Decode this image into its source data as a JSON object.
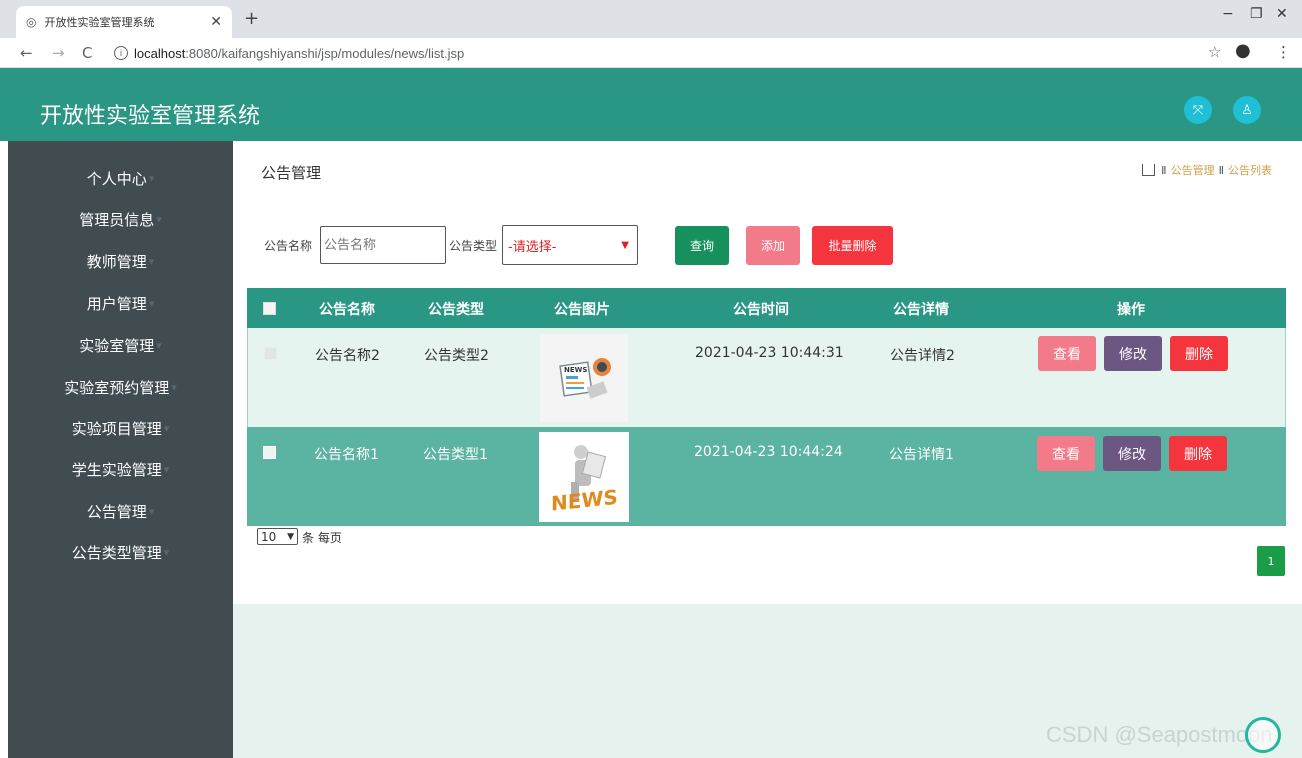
{
  "browser": {
    "tab_title": "开放性实验室管理系统",
    "tab_icon": "settings-icon",
    "url_host": "localhost",
    "url_rest": ":8080/kaifangshiyanshi/jsp/modules/news/list.jsp"
  },
  "header": {
    "title": "开放性实验室管理系统",
    "accent": "#2a9684"
  },
  "sidebar": {
    "items": [
      {
        "label": "个人中心"
      },
      {
        "label": "管理员信息"
      },
      {
        "label": "教师管理"
      },
      {
        "label": "用户管理"
      },
      {
        "label": "实验室管理"
      },
      {
        "label": "实验室预约管理"
      },
      {
        "label": "实验项目管理"
      },
      {
        "label": "学生实验管理"
      },
      {
        "label": "公告管理"
      },
      {
        "label": "公告类型管理"
      }
    ]
  },
  "page": {
    "title": "公告管理",
    "breadcrumb": [
      "公告管理",
      "公告列表"
    ]
  },
  "filters": {
    "name_label": "公告名称",
    "name_placeholder": "公告名称",
    "type_label": "公告类型",
    "type_selected": "-请选择-",
    "search_label": "查询",
    "add_label": "添加",
    "batch_delete_label": "批量删除"
  },
  "table": {
    "headers": [
      "公告名称",
      "公告类型",
      "公告图片",
      "公告时间",
      "公告详情",
      "操作"
    ],
    "rows": [
      {
        "name": "公告名称2",
        "type": "公告类型2",
        "time": "2021-04-23 10:44:31",
        "detail": "公告详情2",
        "image": "news-paper-icon"
      },
      {
        "name": "公告名称1",
        "type": "公告类型1",
        "time": "2021-04-23 10:44:24",
        "detail": "公告详情1",
        "image": "news-figure-icon"
      }
    ],
    "actions": {
      "view": "查看",
      "edit": "修改",
      "delete": "删除"
    }
  },
  "pagination": {
    "page_size": "10",
    "page_size_suffix": "条 每页",
    "current_page": "1"
  },
  "watermark": "CSDN @Seapostmoon"
}
